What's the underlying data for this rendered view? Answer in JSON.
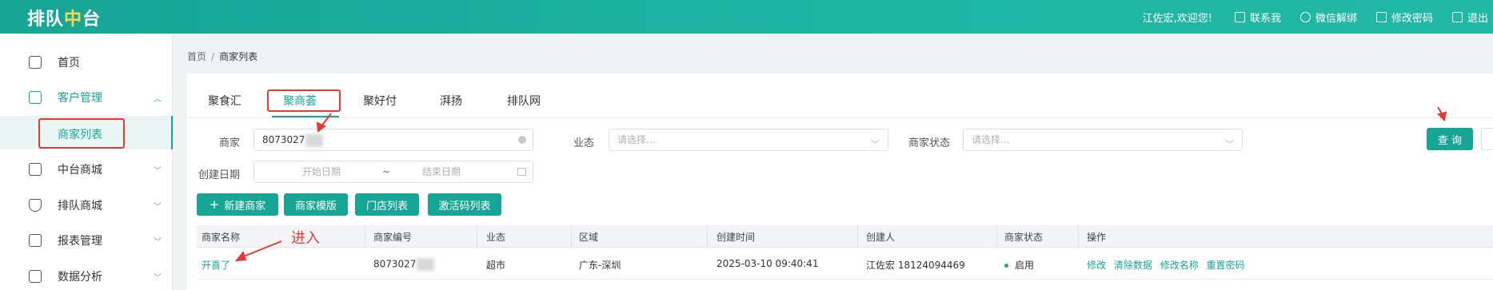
{
  "header": {
    "logo_left": "排队",
    "logo_mid": "中",
    "logo_right": "台",
    "welcome": "江佐宏,欢迎您!",
    "links": [
      {
        "label": "联系我",
        "icon": "grid-icon"
      },
      {
        "label": "微信解绑",
        "icon": "wechat-icon"
      },
      {
        "label": "修改密码",
        "icon": "lock-icon"
      },
      {
        "label": "退出",
        "icon": "logout-icon"
      }
    ]
  },
  "sidebar": {
    "items": [
      {
        "label": "首页",
        "icon": "home-icon"
      },
      {
        "label": "客户管理",
        "icon": "users-icon",
        "expanded": true
      },
      {
        "label": "中台商城",
        "icon": "store-icon"
      },
      {
        "label": "排队商城",
        "icon": "shield-icon"
      },
      {
        "label": "报表管理",
        "icon": "report-icon"
      },
      {
        "label": "数据分析",
        "icon": "chart-icon"
      }
    ],
    "subitem": "商家列表"
  },
  "breadcrumb": {
    "home": "首页",
    "sep": "/",
    "current": "商家列表"
  },
  "tabs": [
    "聚食汇",
    "聚商荟",
    "聚好付",
    "湃扬",
    "排队网"
  ],
  "filters": {
    "merchant_label": "商家",
    "merchant_value": "8073027",
    "business_label": "业态",
    "business_placeholder": "请选择...",
    "status_label": "商家状态",
    "status_placeholder": "请选择...",
    "date_label": "创建日期",
    "date_start": "开始日期",
    "date_sep": "~",
    "date_end": "结束日期",
    "query": "查 询"
  },
  "actions": {
    "new_merchant": "新建商家",
    "merchant_template": "商家模版",
    "store_list": "门店列表",
    "activation_list": "激活码列表"
  },
  "table": {
    "columns": [
      "商家名称",
      "商家编号",
      "业态",
      "区域",
      "创建时间",
      "创建人",
      "商家状态",
      "操作"
    ],
    "rows": [
      {
        "name": "开喜了",
        "code": "8073027",
        "business": "超市",
        "region": "广东-深圳",
        "created": "2025-03-10 09:40:41",
        "creator": "江佐宏 18124094469",
        "status": "启用",
        "ops": [
          "修改",
          "清除数据",
          "修改名称",
          "重置密码"
        ]
      }
    ]
  },
  "annotation": {
    "enter": "进入"
  }
}
